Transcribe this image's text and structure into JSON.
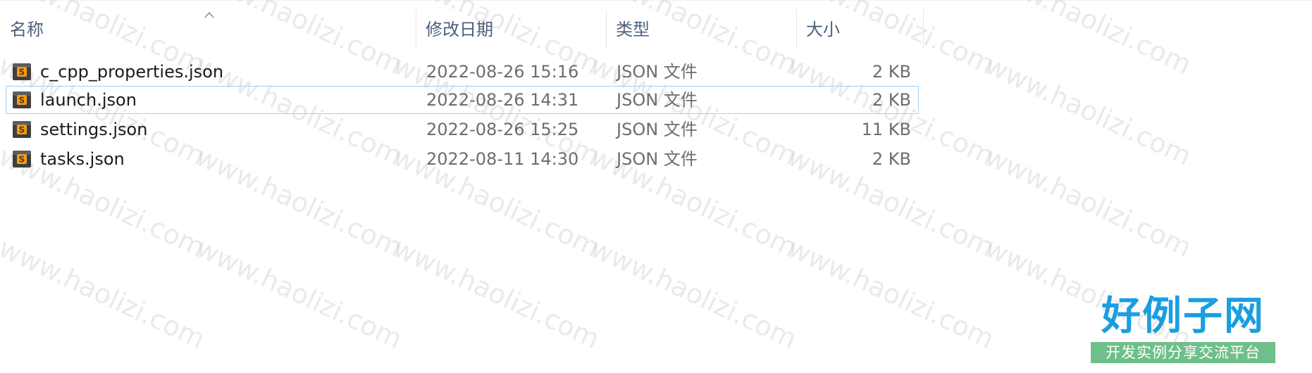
{
  "columns": {
    "name": "名称",
    "modified": "修改日期",
    "type": "类型",
    "size": "大小"
  },
  "files": [
    {
      "name": "c_cpp_properties.json",
      "modified": "2022-08-26 15:16",
      "type": "JSON 文件",
      "size": "2 KB",
      "icon": "sublime-text-file-icon"
    },
    {
      "name": "launch.json",
      "modified": "2022-08-26 14:31",
      "type": "JSON 文件",
      "size": "2 KB",
      "icon": "sublime-text-file-icon",
      "selected": true
    },
    {
      "name": "settings.json",
      "modified": "2022-08-26 15:25",
      "type": "JSON 文件",
      "size": "11 KB",
      "icon": "sublime-text-file-icon"
    },
    {
      "name": "tasks.json",
      "modified": "2022-08-11 14:30",
      "type": "JSON 文件",
      "size": "2 KB",
      "icon": "sublime-text-file-icon"
    }
  ],
  "sort": {
    "column": "name",
    "direction": "ascending",
    "icon": "sort-ascending-icon"
  },
  "watermark": "www.haolizi.com",
  "logo": {
    "title": "好例子网",
    "subtitle": "开发实例分享交流平台"
  },
  "colors": {
    "header_text": "#4c607a",
    "selection_border": "#99d1ff",
    "logo_blue": "#1a9ee0",
    "logo_green": "#6fbf8a"
  }
}
